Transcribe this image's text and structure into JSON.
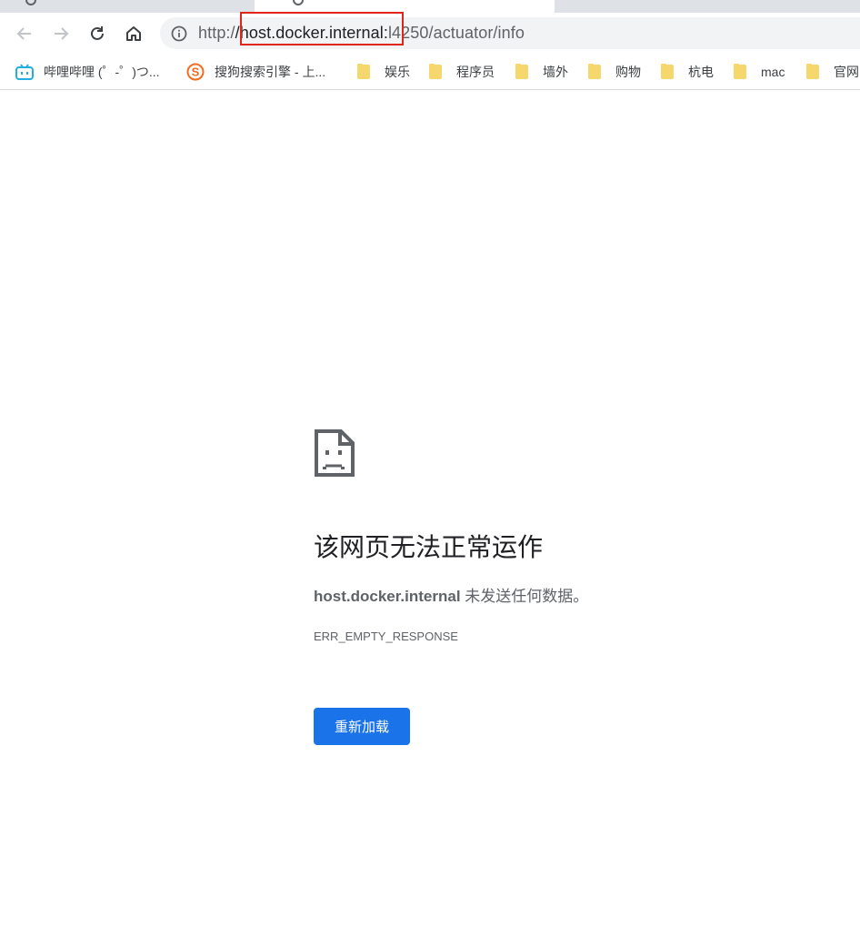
{
  "browser": {
    "url": {
      "scheme": "http:/",
      "host": "/host.docker.internal:",
      "rest": "l4250/actuator/info"
    },
    "bookmarks": [
      {
        "label": "哔哩哔哩 (゜-゜)つ...",
        "icon": "bilibili-icon"
      },
      {
        "label": "搜狗搜索引擎 - 上...",
        "icon": "sogou-icon"
      },
      {
        "label": "娱乐",
        "icon": "folder-icon"
      },
      {
        "label": "程序员",
        "icon": "folder-icon"
      },
      {
        "label": "墙外",
        "icon": "folder-icon"
      },
      {
        "label": "购物",
        "icon": "folder-icon"
      },
      {
        "label": "杭电",
        "icon": "folder-icon"
      },
      {
        "label": "mac",
        "icon": "folder-icon"
      },
      {
        "label": "官网",
        "icon": "folder-icon"
      }
    ]
  },
  "error": {
    "title": "该网页无法正常运作",
    "host": "host.docker.internal",
    "message": " 未发送任何数据。",
    "code": "ERR_EMPTY_RESPONSE",
    "reload_label": "重新加载"
  },
  "colors": {
    "accent": "#1a73e8",
    "highlight": "#e0251b"
  }
}
